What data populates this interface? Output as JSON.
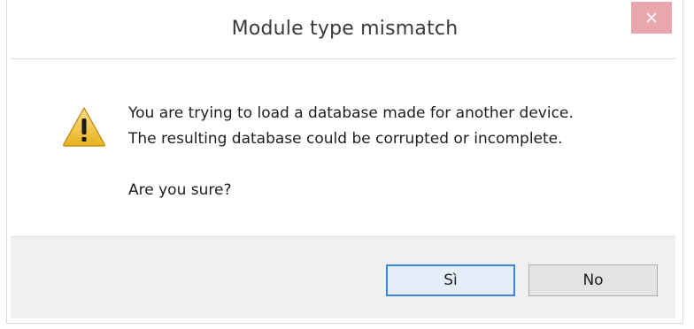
{
  "dialog": {
    "title": "Module type mismatch",
    "close_icon": "close-icon",
    "warning_icon": "warning-icon",
    "message_line1": "You are trying to load a database made for another device.",
    "message_line2": "The resulting database could be corrupted or incomplete.",
    "question": "Are you sure?",
    "buttons": {
      "yes_label": "Sì",
      "no_label": "No"
    }
  },
  "colors": {
    "close_bg": "#e8a7ac",
    "footer_bg": "#f0f0f0",
    "default_button_border": "#3c88d6",
    "warning_yellow": "#f2c744"
  }
}
